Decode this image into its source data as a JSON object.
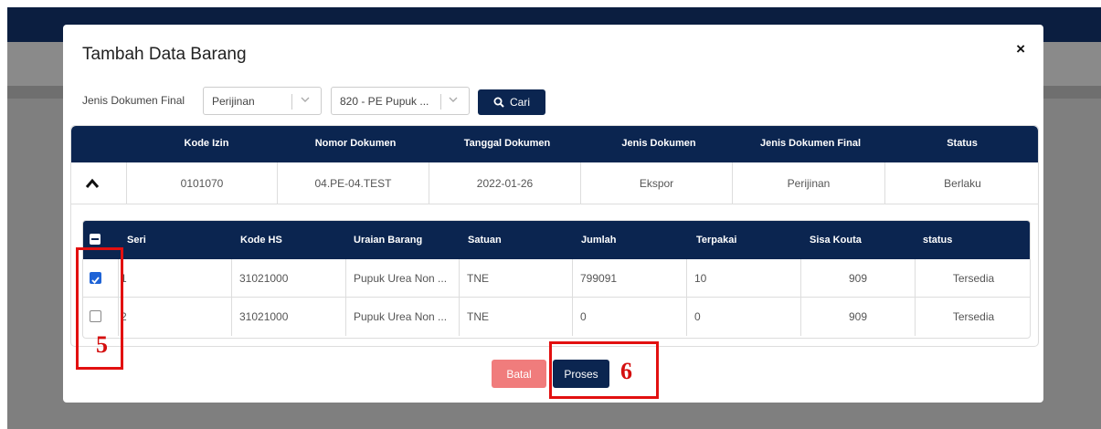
{
  "modal": {
    "title": "Tambah Data Barang",
    "close_symbol": "×"
  },
  "filter": {
    "label": "Jenis Dokumen Final",
    "select1_value": "Perijinan",
    "select2_value": "820 - PE Pupuk ...",
    "search_label": "Cari"
  },
  "outer_table": {
    "headers": [
      "Kode Izin",
      "Nomor Dokumen",
      "Tanggal Dokumen",
      "Jenis Dokumen",
      "Jenis Dokumen Final",
      "Status"
    ],
    "row": [
      "0101070",
      "04.PE-04.TEST",
      "2022-01-26",
      "Ekspor",
      "Perijinan",
      "Berlaku"
    ]
  },
  "inner_table": {
    "headers": [
      "Seri",
      "Kode HS",
      "Uraian Barang",
      "Satuan",
      "Jumlah",
      "Terpakai",
      "Sisa Kouta",
      "status"
    ],
    "rows": [
      {
        "checked": true,
        "cells": [
          "1",
          "31021000",
          "Pupuk Urea Non ...",
          "TNE",
          "799091",
          "10",
          "909",
          "Tersedia"
        ]
      },
      {
        "checked": false,
        "cells": [
          "2",
          "31021000",
          "Pupuk Urea Non ...",
          "TNE",
          "0",
          "0",
          "909",
          "Tersedia"
        ]
      }
    ]
  },
  "buttons": {
    "cancel": "Batal",
    "process": "Proses"
  },
  "annotations": {
    "step5": "5",
    "step6": "6",
    "color": "#e21010"
  },
  "colors": {
    "primary": "#0b2550",
    "cancel": "#f07c7c",
    "checkbox": "#1e63d6"
  }
}
